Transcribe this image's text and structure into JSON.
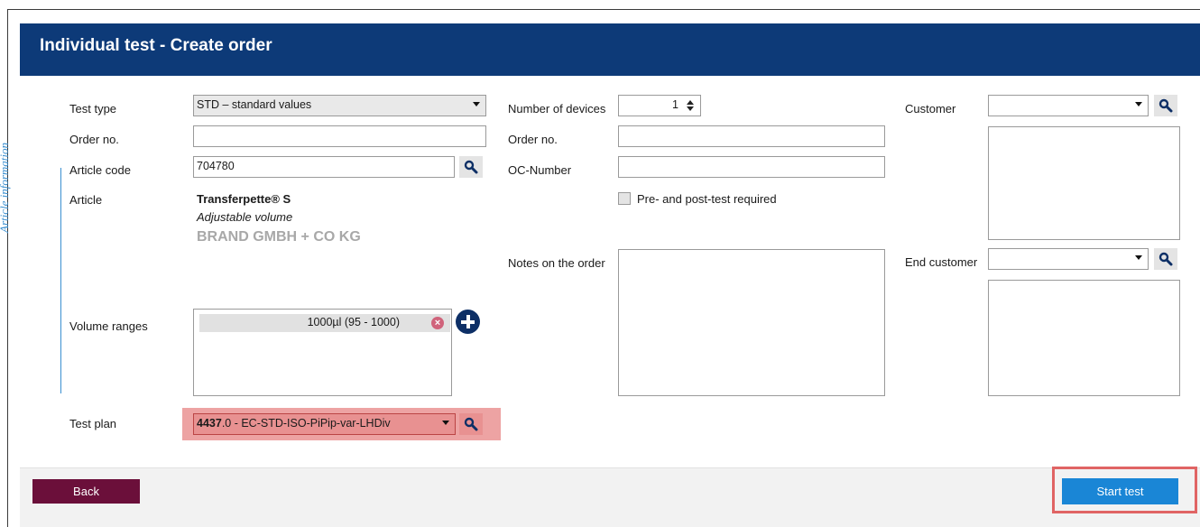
{
  "header": {
    "title": "Individual test - Create order"
  },
  "article_section_label": "Article information",
  "left": {
    "test_type_label": "Test type",
    "test_type_value": "STD – standard values",
    "order_no_label": "Order no.",
    "order_no_value": "",
    "article_code_label": "Article code",
    "article_code_value": "704780",
    "article_label": "Article",
    "article_name": "Transferpette® S",
    "article_subtitle": "Adjustable volume",
    "article_manufacturer": "BRAND GMBH + CO KG",
    "volume_ranges_label": "Volume ranges",
    "volume_ranges": [
      "1000µl (95 - 1000)"
    ],
    "test_plan_label": "Test plan",
    "test_plan_number": "4437",
    "test_plan_rest": ".0 - EC-STD-ISO-PiPip-var-LHDiv"
  },
  "middle": {
    "num_devices_label": "Number of devices",
    "num_devices_value": "1",
    "order_no_label": "Order no.",
    "order_no_value": "",
    "oc_number_label": "OC-Number",
    "oc_number_value": "",
    "pre_post_label": "Pre- and post-test required",
    "pre_post_checked": false,
    "notes_label": "Notes on the order",
    "notes_value": ""
  },
  "right": {
    "customer_label": "Customer",
    "customer_value": "",
    "end_customer_label": "End customer",
    "end_customer_value": ""
  },
  "footer": {
    "back_label": "Back",
    "start_label": "Start test"
  },
  "colors": {
    "header_bg": "#0d3a78",
    "back_bg": "#6b0f3a",
    "start_bg": "#1a86d6",
    "highlight": "#eda3a3",
    "highlight_border": "#e06464",
    "section_line": "#3a8fd0"
  },
  "icons": [
    "search-icon",
    "dropdown-caret-icon",
    "remove-icon",
    "add-icon",
    "spinner-icon",
    "checkbox-icon"
  ]
}
